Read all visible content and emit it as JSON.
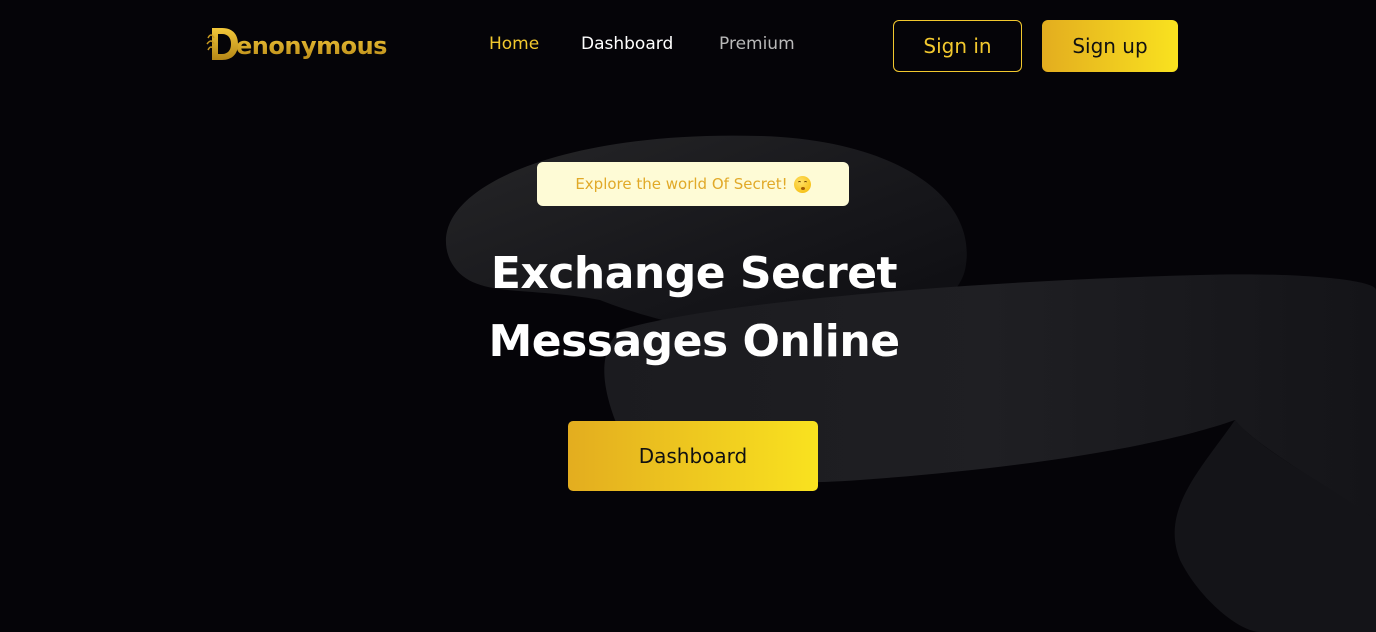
{
  "brand": {
    "logo_text": "enonymous",
    "logo_mark_letter": "D"
  },
  "nav": {
    "links": [
      {
        "label": "Home",
        "active": true
      },
      {
        "label": "Dashboard",
        "active": false
      },
      {
        "label": "Premium",
        "active": false
      }
    ],
    "signin_label": "Sign in",
    "signup_label": "Sign up"
  },
  "hero": {
    "tag_text": "Explore the world Of Secret!",
    "tag_icon": "shushing-face-icon",
    "headline_line1": "Exchange Secret",
    "headline_line2": "Messages Online",
    "cta_label": "Dashboard"
  },
  "colors": {
    "background": "#050408",
    "accent": "#f2c82e",
    "accent_gradient_start": "#e3ad1f",
    "accent_gradient_end": "#f9e21f",
    "tag_background": "#fefbd6",
    "tag_text": "#e1a928",
    "nav_inactive": "#b9b9b9"
  }
}
